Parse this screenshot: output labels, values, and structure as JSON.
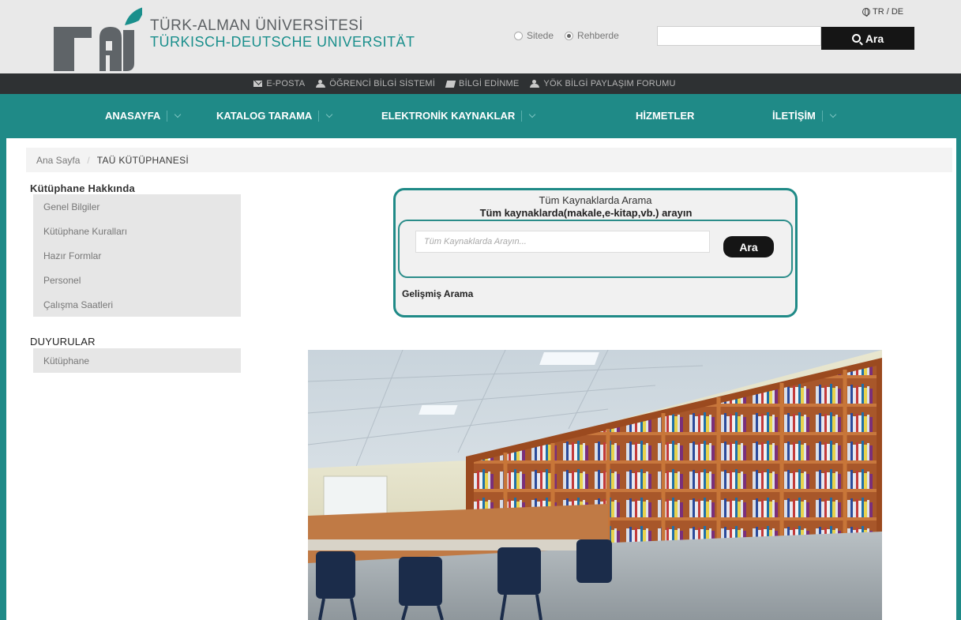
{
  "header": {
    "logo_text": "tau",
    "university_tr": "TÜRK-ALMAN ÜNİVERSİTESİ",
    "university_de": "TÜRKISCH-DEUTSCHE UNIVERSITÄT",
    "language_switch": "TR / DE",
    "search_scope_options": [
      "Sitede",
      "Rehberde"
    ],
    "search_scope_selected": "Rehberde",
    "search_input_value": "",
    "search_button": "Ara"
  },
  "quick_links": [
    {
      "label": "E-POSTA",
      "icon": "envelope-icon"
    },
    {
      "label": "ÖĞRENCİ BİLGİ SİSTEMİ",
      "icon": "users-icon"
    },
    {
      "label": "BİLGİ EDİNME",
      "icon": "book-icon"
    },
    {
      "label": "YÖK BİLGİ PAYLAŞIM FORUMU",
      "icon": "users-icon"
    }
  ],
  "main_nav": [
    "ANASAYFA",
    "KATALOG TARAMA",
    "ELEKTRONİK KAYNAKLAR",
    "HİZMETLER",
    "İLETİŞİM"
  ],
  "breadcrumb": {
    "home": "Ana Sayfa",
    "current": "TAÜ KÜTÜPHANESİ"
  },
  "sidebar": {
    "about_title": "Kütüphane Hakkında",
    "about_items": [
      "Genel Bilgiler",
      "Kütüphane Kuralları",
      "Hazır Formlar",
      "Personel",
      "Çalışma Saatleri"
    ],
    "announcements_title": "DUYURULAR",
    "announcement_items": [
      "Kütüphane"
    ]
  },
  "search_panel": {
    "title": "Tüm Kaynaklarda Arama",
    "subtitle": "Tüm kaynaklarda(makale,e-kitap,vb.) arayın",
    "placeholder": "Tüm Kaynaklarda Arayın...",
    "button": "Ara",
    "advanced_link": "Gelişmiş Arama"
  },
  "colors": {
    "teal": "#1f8a87",
    "dark_bar": "#2e3133",
    "button_black": "#151515"
  }
}
